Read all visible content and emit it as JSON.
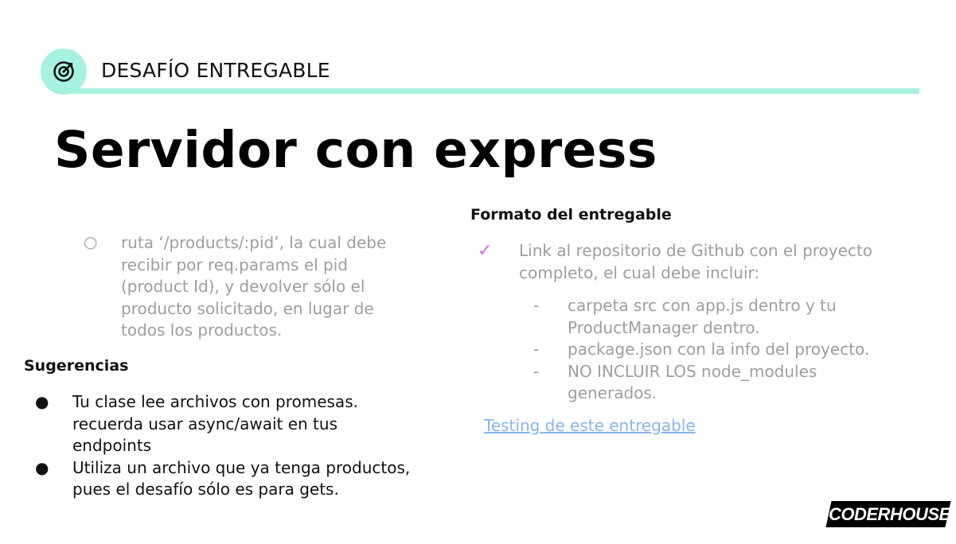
{
  "header": {
    "label": "DESAFÍO ENTREGABLE",
    "icon": "target-icon",
    "accent_color": "#a6f2e1"
  },
  "title": "Servidor con express",
  "left": {
    "sub_bullet": "○",
    "sub_text": "ruta ‘/products/:pid’, la cual debe recibir por req.params el pid (product Id), y devolver sólo el producto solicitado, en lugar de todos los productos.",
    "suggestions_heading": "Sugerencias",
    "suggestions": [
      "Tu clase lee archivos con promesas. recuerda usar async/await en tus endpoints",
      "Utiliza un archivo que ya tenga productos, pues el desafío sólo es para gets."
    ]
  },
  "right": {
    "heading": "Formato del entregable",
    "check": "✓",
    "main_text": "Link al repositorio de Github con el proyecto completo, el cual debe incluir:",
    "items": [
      "carpeta src con app.js dentro y tu ProductManager dentro.",
      "package.json con la info del proyecto.",
      "NO INCLUIR LOS node_modules generados."
    ],
    "link_text": "Testing de este entregable"
  },
  "logo": {
    "text": "CODERHOUSE"
  }
}
